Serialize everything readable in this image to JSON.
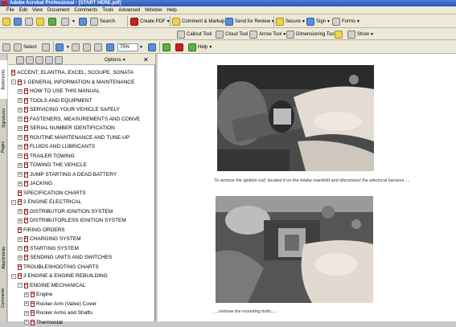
{
  "window": {
    "title": "Adobe Acrobat Professional - [START HERE.pdf]"
  },
  "menu": [
    "File",
    "Edit",
    "View",
    "Document",
    "Comments",
    "Tools",
    "Advanced",
    "Window",
    "Help"
  ],
  "toolbar1": {
    "search_label": "Search"
  },
  "toolbar2": {
    "create_pdf": "Create PDF",
    "comment_markup": "Comment & Markup",
    "send_review": "Send for Review",
    "secure": "Secure",
    "sign": "Sign",
    "forms": "Forms"
  },
  "toolbar3": {
    "callout": "Callout Tool",
    "cloud": "Cloud Tool",
    "arrow": "Arrow Tool",
    "dimensioning": "Dimensioning Tool",
    "show": "Show"
  },
  "toolbar4": {
    "select": "Select",
    "zoom": "75%",
    "help": "Help"
  },
  "sidebar_tabs": [
    "Bookmarks",
    "Signatures",
    "Pages",
    "Attachments",
    "Comments"
  ],
  "panel": {
    "options": "Options"
  },
  "bookmarks": [
    {
      "label": "ACCENT, ELANTRA, EXCEL, SCOUPE, SONATA",
      "level": 0,
      "exp": ""
    },
    {
      "label": "1  GENERAL INFORMATION & MAINTENANCE",
      "level": 0,
      "exp": "−"
    },
    {
      "label": "HOW TO USE THIS MANUAL",
      "level": 1,
      "exp": "+"
    },
    {
      "label": "TOOLS AND EQUIPMENT",
      "level": 1,
      "exp": "+"
    },
    {
      "label": "SERVICING YOUR VEHICLE SAFELY",
      "level": 1,
      "exp": "+"
    },
    {
      "label": " FASTENERS, MEASUREMENTS AND CONVE",
      "level": 1,
      "exp": "+"
    },
    {
      "label": "SERIAL NUMBER IDENTIFICATION",
      "level": 1,
      "exp": "+"
    },
    {
      "label": " ROUTINE MAINTENANCE AND TUNE-UP",
      "level": 1,
      "exp": "+"
    },
    {
      "label": "FLUIDS AND LUBRICANTS",
      "level": 1,
      "exp": "+"
    },
    {
      "label": "TRAILER TOWING",
      "level": 1,
      "exp": "+"
    },
    {
      "label": "TOWING THE VEHICLE",
      "level": 1,
      "exp": "+"
    },
    {
      "label": "JUMP STARTING A DEAD BATTERY",
      "level": 1,
      "exp": "+"
    },
    {
      "label": "JACKING",
      "level": 1,
      "exp": "+"
    },
    {
      "label": "SPECIFICATION CHARTS",
      "level": 1,
      "exp": ""
    },
    {
      "label": "2  ENGINE ELECTRICAL",
      "level": 0,
      "exp": "−"
    },
    {
      "label": "DISTRIBUTOR IGNITION SYSTEM",
      "level": 1,
      "exp": "+"
    },
    {
      "label": "DISTRIBUTORLESS IGNITION SYSTEM",
      "level": 1,
      "exp": "+"
    },
    {
      "label": "FIRING ORDERS",
      "level": 1,
      "exp": ""
    },
    {
      "label": "CHARGING SYSTEM",
      "level": 1,
      "exp": "+"
    },
    {
      "label": "STARTING SYSTEM",
      "level": 1,
      "exp": "+"
    },
    {
      "label": "SENDING UNITS AND SWITCHES",
      "level": 1,
      "exp": "+"
    },
    {
      "label": "TROUBLESHOOTING CHARTS",
      "level": 1,
      "exp": ""
    },
    {
      "label": "3  ENGINE & ENGINE REBUILDING",
      "level": 0,
      "exp": "−"
    },
    {
      "label": "ENGINE MECHANICAL",
      "level": 1,
      "exp": "−"
    },
    {
      "label": "Engine",
      "level": 2,
      "exp": "+"
    },
    {
      "label": "Rocker Arm (Valve) Cover",
      "level": 2,
      "exp": "+"
    },
    {
      "label": "Rocker Arms and Shafts",
      "level": 2,
      "exp": "+"
    },
    {
      "label": "Thermostat",
      "level": 2,
      "exp": "+"
    }
  ],
  "document": {
    "caption1": "To remove the ignition coil, located it on the intake manifold and disconnect the electrical harness.....",
    "caption2": "....remove the mounting bolts....."
  }
}
